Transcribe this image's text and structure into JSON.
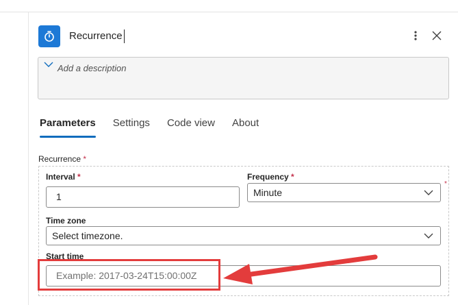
{
  "header": {
    "title": "Recurrence",
    "icon": "timer-icon",
    "more_icon": "more-vertical-icon",
    "close_icon": "close-icon"
  },
  "description": {
    "placeholder": "Add a description",
    "chevron_icon": "chevron-down-icon"
  },
  "tabs": [
    {
      "label": "Parameters",
      "active": true
    },
    {
      "label": "Settings",
      "active": false
    },
    {
      "label": "Code view",
      "active": false
    },
    {
      "label": "About",
      "active": false
    }
  ],
  "recurrence": {
    "label": "Recurrence",
    "required_mark": "*",
    "interval": {
      "label": "Interval",
      "required_mark": "*",
      "value": "1"
    },
    "frequency": {
      "label": "Frequency",
      "required_mark": "*",
      "value": "Minute"
    },
    "time_zone": {
      "label": "Time zone",
      "value": "Select timezone."
    },
    "start_time": {
      "label": "Start time",
      "placeholder": "Example: 2017-03-24T15:00:00Z"
    }
  },
  "annotation": {
    "highlight_color": "#e33c3c",
    "arrow_color": "#e33c3c"
  },
  "colors": {
    "accent": "#0f6cbd",
    "icon_bg": "#1d79d6",
    "required": "#c4314b"
  }
}
